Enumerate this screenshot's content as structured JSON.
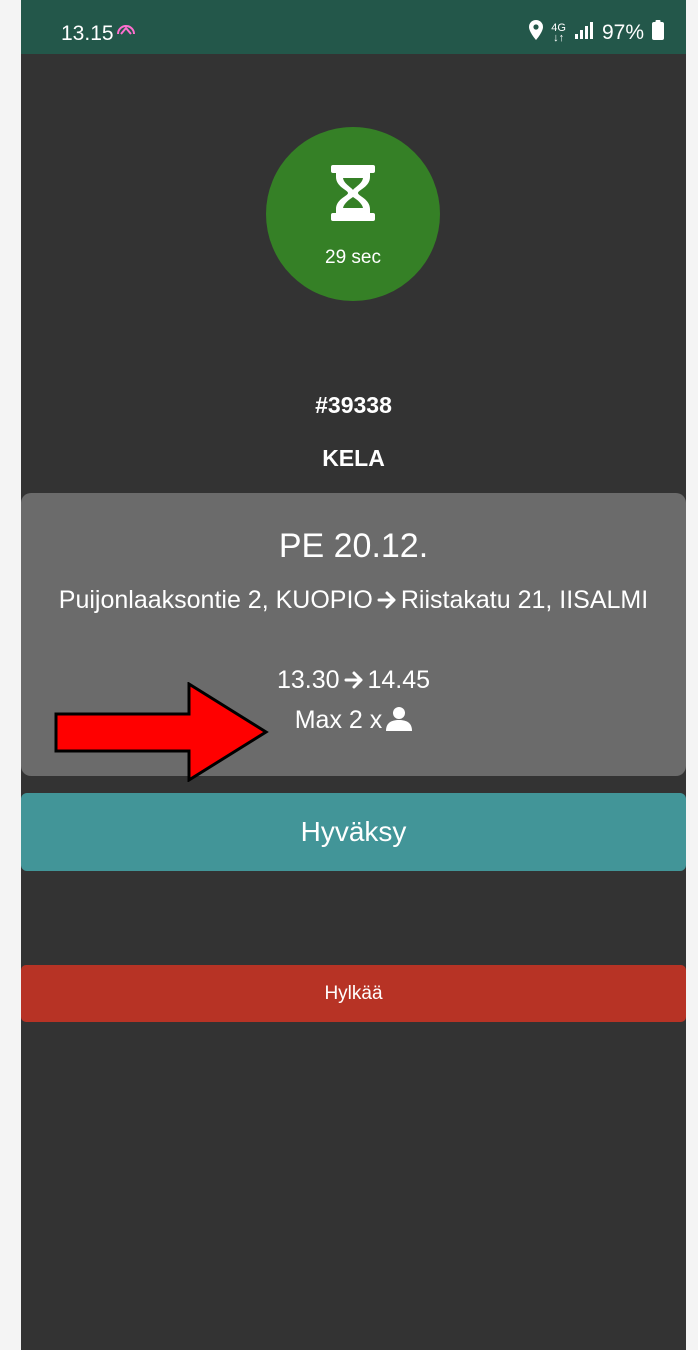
{
  "status_bar": {
    "time": "13.15",
    "network_top": "4G",
    "network_bottom": "↓↑",
    "battery": "97%"
  },
  "timer": {
    "label": "29 sec"
  },
  "order": {
    "id": "#39338",
    "client": "KELA"
  },
  "trip": {
    "date": "PE 20.12.",
    "from": "Puijonlaaksontie 2, KUOPIO",
    "to": "Riistakatu 21, IISALMI",
    "depart": "13.30",
    "arrive": "14.45",
    "passengers": "Max 2 x"
  },
  "actions": {
    "accept_label": "Hyväksy",
    "reject_label": "Hylkää"
  },
  "colors": {
    "status_bar": "#23574a",
    "background": "#333333",
    "timer": "#358026",
    "card": "#6b6b6b",
    "accept": "#429598",
    "reject": "#b73325",
    "annotation_arrow": "#ff0000"
  },
  "icons": {
    "timer": "hourglass-icon",
    "route": "arrow-right-icon",
    "passenger": "person-icon",
    "location": "location-pin-icon",
    "signal": "signal-icon",
    "battery": "battery-icon",
    "annotation": "red-arrow-icon"
  }
}
